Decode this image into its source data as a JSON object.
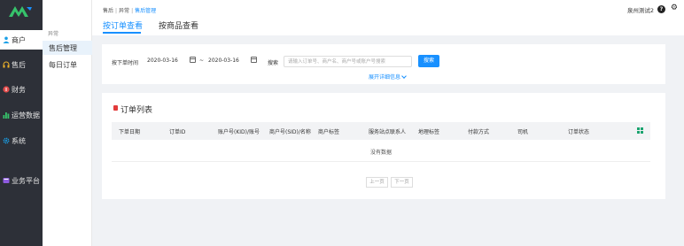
{
  "nav": {
    "items": [
      {
        "label": "商户",
        "icon": "person-icon",
        "active": true
      },
      {
        "label": "售后",
        "icon": "headset-icon",
        "active": false
      },
      {
        "label": "财务",
        "icon": "finance-icon",
        "active": false
      },
      {
        "label": "运营数据",
        "icon": "bar-chart-icon",
        "active": false
      },
      {
        "label": "系统",
        "icon": "gear-icon",
        "active": false
      },
      {
        "label": "业务平台",
        "icon": "platform-icon",
        "active": false
      }
    ],
    "colors": {
      "bg": "#2d3038",
      "accent": "#1890ff"
    }
  },
  "submenu": {
    "title": "异常",
    "items": [
      {
        "label": "售后管理",
        "active": true
      },
      {
        "label": "每日订单",
        "active": false
      }
    ]
  },
  "breadcrumb": {
    "a": "售后",
    "b": "异常",
    "c": "售后管理",
    "sep": "|"
  },
  "user": {
    "name": "泉州测试2"
  },
  "tabs": [
    {
      "label": "按订单查看",
      "active": true
    },
    {
      "label": "按商品查看",
      "active": false
    }
  ],
  "filter": {
    "time_label": "按下单时间",
    "start_date": "2020-03-16",
    "range_sep": "~",
    "end_date": "2020-03-16",
    "search_label": "搜索",
    "search_placeholder": "请输入订单号、商户名、商户号或账户号搜索",
    "search_button": "搜索",
    "expand_label": "展开详细信息"
  },
  "order_list": {
    "title": "订单列表",
    "columns": [
      "下单日期",
      "订单ID",
      "账户号(KID)/账号",
      "商户号(SID)/名称",
      "商户标签",
      "服务站点联系人",
      "地理标签",
      "付款方式",
      "司机",
      "订单状态"
    ],
    "empty_text": "没有数据",
    "prev_page": "上一页",
    "next_page": "下一页"
  }
}
